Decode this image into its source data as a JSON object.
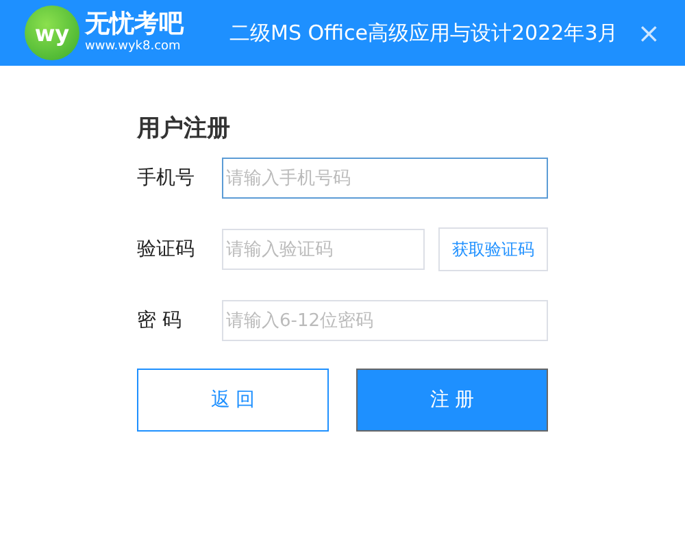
{
  "header": {
    "logo_mark": "wy",
    "logo_name": "无忧考吧",
    "logo_url": "www.wyk8.com",
    "title": "二级MS Office高级应用与设计2022年3月",
    "close": "×"
  },
  "form": {
    "title": "用户注册",
    "fields": [
      {
        "label": "手机号",
        "placeholder": "请输入手机号码",
        "focused": true
      },
      {
        "label": "验证码",
        "placeholder": "请输入验证码",
        "focused": false,
        "button": "获取验证码"
      },
      {
        "label": "密 码",
        "placeholder": "请输入6-12位密码",
        "focused": false
      }
    ],
    "buttons": [
      {
        "label": "返 回",
        "kind": "secondary"
      },
      {
        "label": "注 册",
        "kind": "primary"
      }
    ]
  }
}
